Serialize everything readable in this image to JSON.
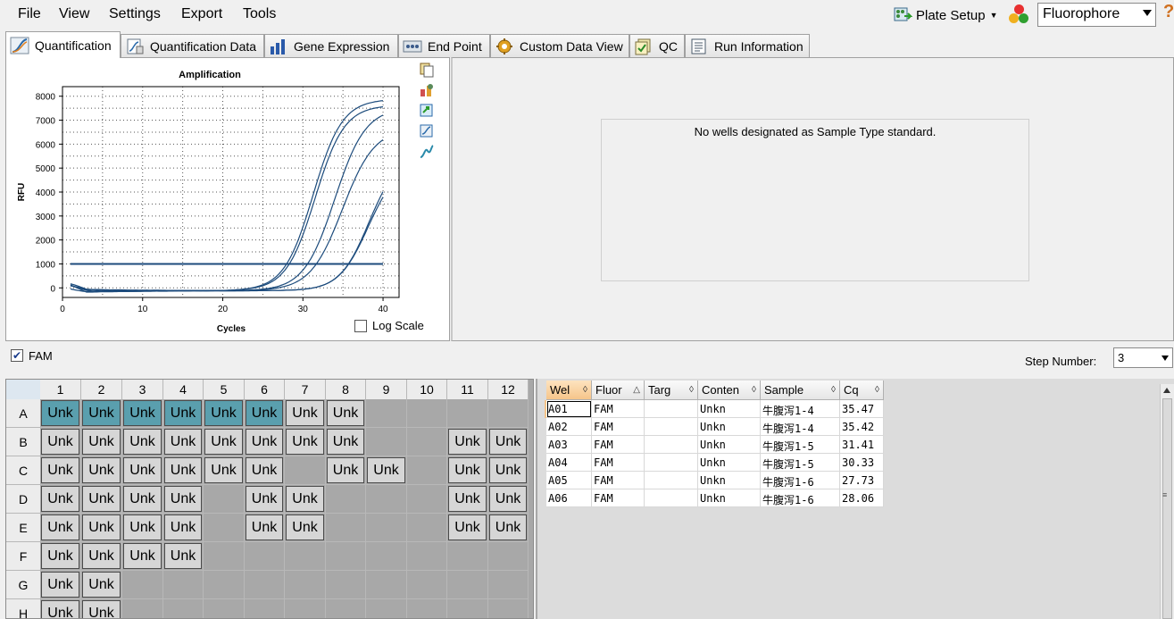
{
  "menu": {
    "items": [
      "File",
      "View",
      "Settings",
      "Export",
      "Tools"
    ]
  },
  "toolbar": {
    "plate_setup_label": "Plate Setup",
    "fluorophore_value": "Fluorophore"
  },
  "tabs": [
    {
      "label": "Quantification",
      "icon": "amplification-curve-icon"
    },
    {
      "label": "Quantification Data",
      "icon": "data-sheet-icon"
    },
    {
      "label": "Gene Expression",
      "icon": "bar-chart-icon"
    },
    {
      "label": "End Point",
      "icon": "endpoint-icon"
    },
    {
      "label": "Custom Data View",
      "icon": "gear-icon"
    },
    {
      "label": "QC",
      "icon": "qc-check-icon"
    },
    {
      "label": "Run Information",
      "icon": "run-info-icon"
    }
  ],
  "chart_data": {
    "type": "line",
    "title": "Amplification",
    "xlabel": "Cycles",
    "ylabel": "RFU",
    "xlim": [
      0,
      42
    ],
    "ylim": [
      -400,
      8400
    ],
    "x_ticks": [
      0,
      10,
      20,
      30,
      40
    ],
    "y_ticks": [
      0,
      1000,
      2000,
      3000,
      4000,
      5000,
      6000,
      7000,
      8000
    ],
    "threshold": 1000,
    "grid": true,
    "log_scale": false,
    "series_color": "#1c4b7c",
    "series": [
      {
        "cq": 27.73,
        "plateau": 8000,
        "k": 0.55
      },
      {
        "cq": 28.06,
        "plateau": 7750,
        "k": 0.55
      },
      {
        "cq": 30.33,
        "plateau": 7650,
        "k": 0.52
      },
      {
        "cq": 31.41,
        "plateau": 6800,
        "k": 0.5
      },
      {
        "cq": 35.42,
        "plateau": 5700,
        "k": 0.55
      },
      {
        "cq": 35.47,
        "plateau": 5300,
        "k": 0.55
      }
    ]
  },
  "chart": {
    "log_scale_label": "Log Scale"
  },
  "standard_message": "No wells designated as Sample Type standard.",
  "filter": {
    "fam_label": "FAM",
    "step_label": "Step Number:",
    "step_value": "3"
  },
  "plate": {
    "columns": [
      "1",
      "2",
      "3",
      "4",
      "5",
      "6",
      "7",
      "8",
      "9",
      "10",
      "11",
      "12"
    ],
    "rows": [
      "A",
      "B",
      "C",
      "D",
      "E",
      "F",
      "G",
      "H"
    ],
    "well_label": "Unk",
    "wells": [
      [
        1,
        1,
        1,
        1,
        1,
        1,
        1,
        1,
        0,
        0,
        0,
        0
      ],
      [
        1,
        1,
        1,
        1,
        1,
        1,
        1,
        1,
        0,
        0,
        1,
        1
      ],
      [
        1,
        1,
        1,
        1,
        1,
        1,
        0,
        1,
        1,
        0,
        1,
        1
      ],
      [
        1,
        1,
        1,
        1,
        0,
        1,
        1,
        0,
        0,
        0,
        1,
        1
      ],
      [
        1,
        1,
        1,
        1,
        0,
        1,
        1,
        0,
        0,
        0,
        1,
        1
      ],
      [
        1,
        1,
        1,
        1,
        0,
        0,
        0,
        0,
        0,
        0,
        0,
        0
      ],
      [
        1,
        1,
        0,
        0,
        0,
        0,
        0,
        0,
        0,
        0,
        0,
        0
      ],
      [
        1,
        1,
        0,
        0,
        0,
        0,
        0,
        0,
        0,
        0,
        0,
        0
      ]
    ],
    "selected_wells": [
      "A1",
      "A2",
      "A3",
      "A4",
      "A5",
      "A6"
    ]
  },
  "table": {
    "headers": [
      "Wel",
      "Fluor",
      "Targ",
      "Conten",
      "Sample",
      "Cq"
    ],
    "rows": [
      [
        "A01",
        "FAM",
        "",
        "Unkn",
        "牛腹泻1-4",
        "35.47"
      ],
      [
        "A02",
        "FAM",
        "",
        "Unkn",
        "牛腹泻1-4",
        "35.42"
      ],
      [
        "A03",
        "FAM",
        "",
        "Unkn",
        "牛腹泻1-5",
        "31.41"
      ],
      [
        "A04",
        "FAM",
        "",
        "Unkn",
        "牛腹泻1-5",
        "30.33"
      ],
      [
        "A05",
        "FAM",
        "",
        "Unkn",
        "牛腹泻1-6",
        "27.73"
      ],
      [
        "A06",
        "FAM",
        "",
        "Unkn",
        "牛腹泻1-6",
        "28.06"
      ]
    ]
  }
}
